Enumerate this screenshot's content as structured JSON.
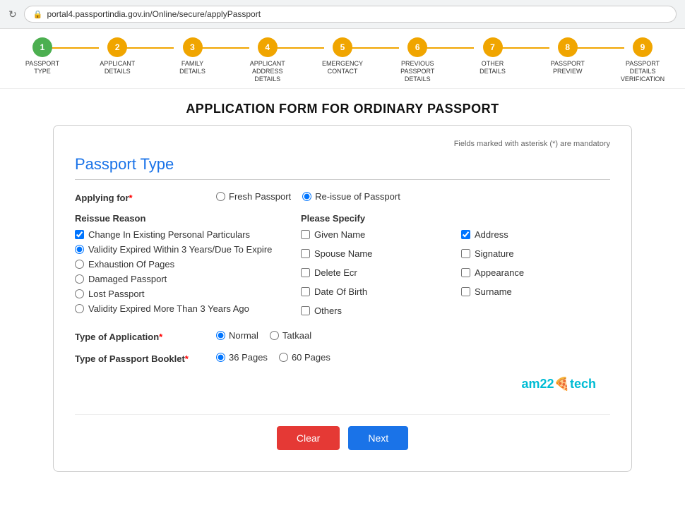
{
  "browser": {
    "url": "portal4.passportindia.gov.in/Online/secure/applyPassport",
    "lock_icon": "🔒",
    "refresh_icon": "↻"
  },
  "steps": [
    {
      "number": "1",
      "label": "PASSPORT TYPE",
      "state": "done"
    },
    {
      "number": "2",
      "label": "APPLICANT DETAILS",
      "state": "active"
    },
    {
      "number": "3",
      "label": "FAMILY DETAILS",
      "state": "active"
    },
    {
      "number": "4",
      "label": "APPLICANT ADDRESS DETAILS",
      "state": "active"
    },
    {
      "number": "5",
      "label": "EMERGENCY CONTACT",
      "state": "active"
    },
    {
      "number": "6",
      "label": "PREVIOUS PASSPORT DETAILS",
      "state": "active"
    },
    {
      "number": "7",
      "label": "OTHER DETAILS",
      "state": "active"
    },
    {
      "number": "8",
      "label": "PASSPORT PREVIEW",
      "state": "active"
    },
    {
      "number": "9",
      "label": "PASSPORT DETAILS VERIFICATION",
      "state": "active"
    }
  ],
  "form": {
    "title": "APPLICATION FORM FOR ORDINARY PASSPORT",
    "mandatory_note": "Fields marked with asterisk (*) are mandatory",
    "section_title": "Passport Type",
    "applying_for_label": "Applying for",
    "applying_for_options": [
      {
        "id": "fresh",
        "label": "Fresh Passport",
        "checked": false
      },
      {
        "id": "reissue",
        "label": "Re-issue of Passport",
        "checked": true
      }
    ],
    "reissue_reason_label": "Reissue Reason",
    "reissue_options": [
      {
        "id": "change_personal",
        "label": "Change In Existing Personal Particulars",
        "checked": true
      },
      {
        "id": "validity_expired_3",
        "label": "Validity Expired Within 3 Years/Due To Expire",
        "checked": false,
        "radio": true,
        "selected": true
      },
      {
        "id": "exhaustion_pages",
        "label": "Exhaustion Of Pages",
        "radio": true
      },
      {
        "id": "damaged",
        "label": "Damaged Passport",
        "radio": true
      },
      {
        "id": "lost",
        "label": "Lost Passport",
        "radio": true
      },
      {
        "id": "validity_expired_more",
        "label": "Validity Expired More Than 3 Years Ago",
        "radio": true
      }
    ],
    "please_specify_label": "Please Specify",
    "specify_options": [
      {
        "id": "given_name",
        "label": "Given Name",
        "checked": false
      },
      {
        "id": "address",
        "label": "Address",
        "checked": true
      },
      {
        "id": "spouse_name",
        "label": "Spouse Name",
        "checked": false
      },
      {
        "id": "signature",
        "label": "Signature",
        "checked": false
      },
      {
        "id": "delete_ecr",
        "label": "Delete Ecr",
        "checked": false
      },
      {
        "id": "appearance",
        "label": "Appearance",
        "checked": false
      },
      {
        "id": "date_of_birth",
        "label": "Date Of Birth",
        "checked": false
      },
      {
        "id": "surname",
        "label": "Surname",
        "checked": false
      },
      {
        "id": "others",
        "label": "Others",
        "checked": false
      }
    ],
    "type_of_application_label": "Type of Application",
    "application_options": [
      {
        "id": "normal",
        "label": "Normal",
        "selected": true
      },
      {
        "id": "tatkaal",
        "label": "Tatkaal",
        "selected": false
      }
    ],
    "type_of_booklet_label": "Type of Passport Booklet",
    "booklet_options": [
      {
        "id": "36pages",
        "label": "36 Pages",
        "selected": true
      },
      {
        "id": "60pages",
        "label": "60 Pages",
        "selected": false
      }
    ],
    "clear_button": "Clear",
    "next_button": "Next"
  },
  "branding": {
    "text_left": "am22",
    "icon": "🍕",
    "text_right": "tech"
  }
}
